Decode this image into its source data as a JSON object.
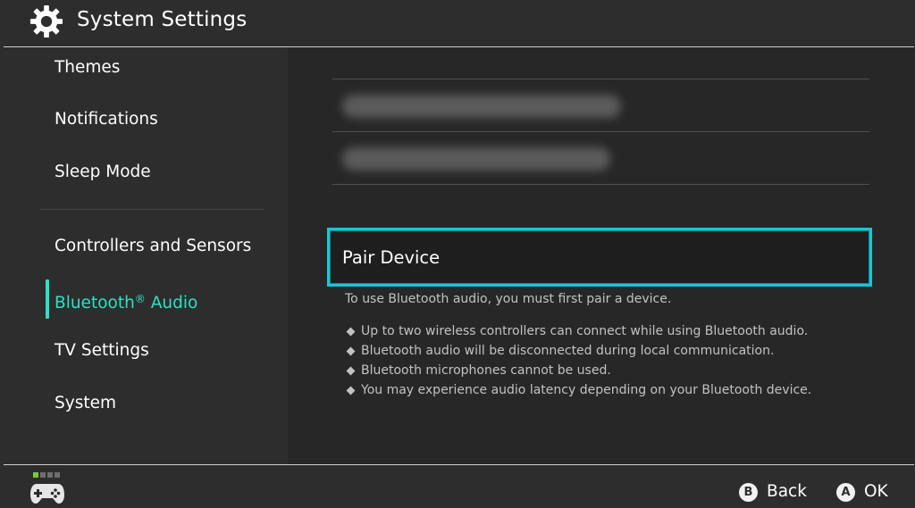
{
  "header": {
    "title": "System Settings",
    "icon": "gear-icon"
  },
  "sidebar": {
    "items": [
      {
        "label": "Themes"
      },
      {
        "label": "Notifications"
      },
      {
        "label": "Sleep Mode"
      },
      {
        "label": "Controllers and Sensors"
      },
      {
        "label": "Bluetooth",
        "suffix": "®",
        "label_rest": " Audio",
        "active": true
      },
      {
        "label": "TV Settings"
      },
      {
        "label": "System"
      }
    ]
  },
  "main": {
    "pair_device_label": "Pair Device",
    "info_text": "To use Bluetooth audio, you must first pair a device.",
    "bullets": [
      "Up to two wireless controllers can connect while using Bluetooth audio.",
      "Bluetooth audio will be disconnected during local communication.",
      "Bluetooth microphones cannot be used.",
      "You may experience audio latency depending on your Bluetooth device."
    ]
  },
  "footer": {
    "back_button": {
      "key": "B",
      "label": "Back"
    },
    "ok_button": {
      "key": "A",
      "label": "OK"
    }
  },
  "colors": {
    "accent": "#2ee0c6",
    "focus_border": "#17c6d6",
    "background": "#2d2d2d",
    "content_background": "#272727"
  }
}
